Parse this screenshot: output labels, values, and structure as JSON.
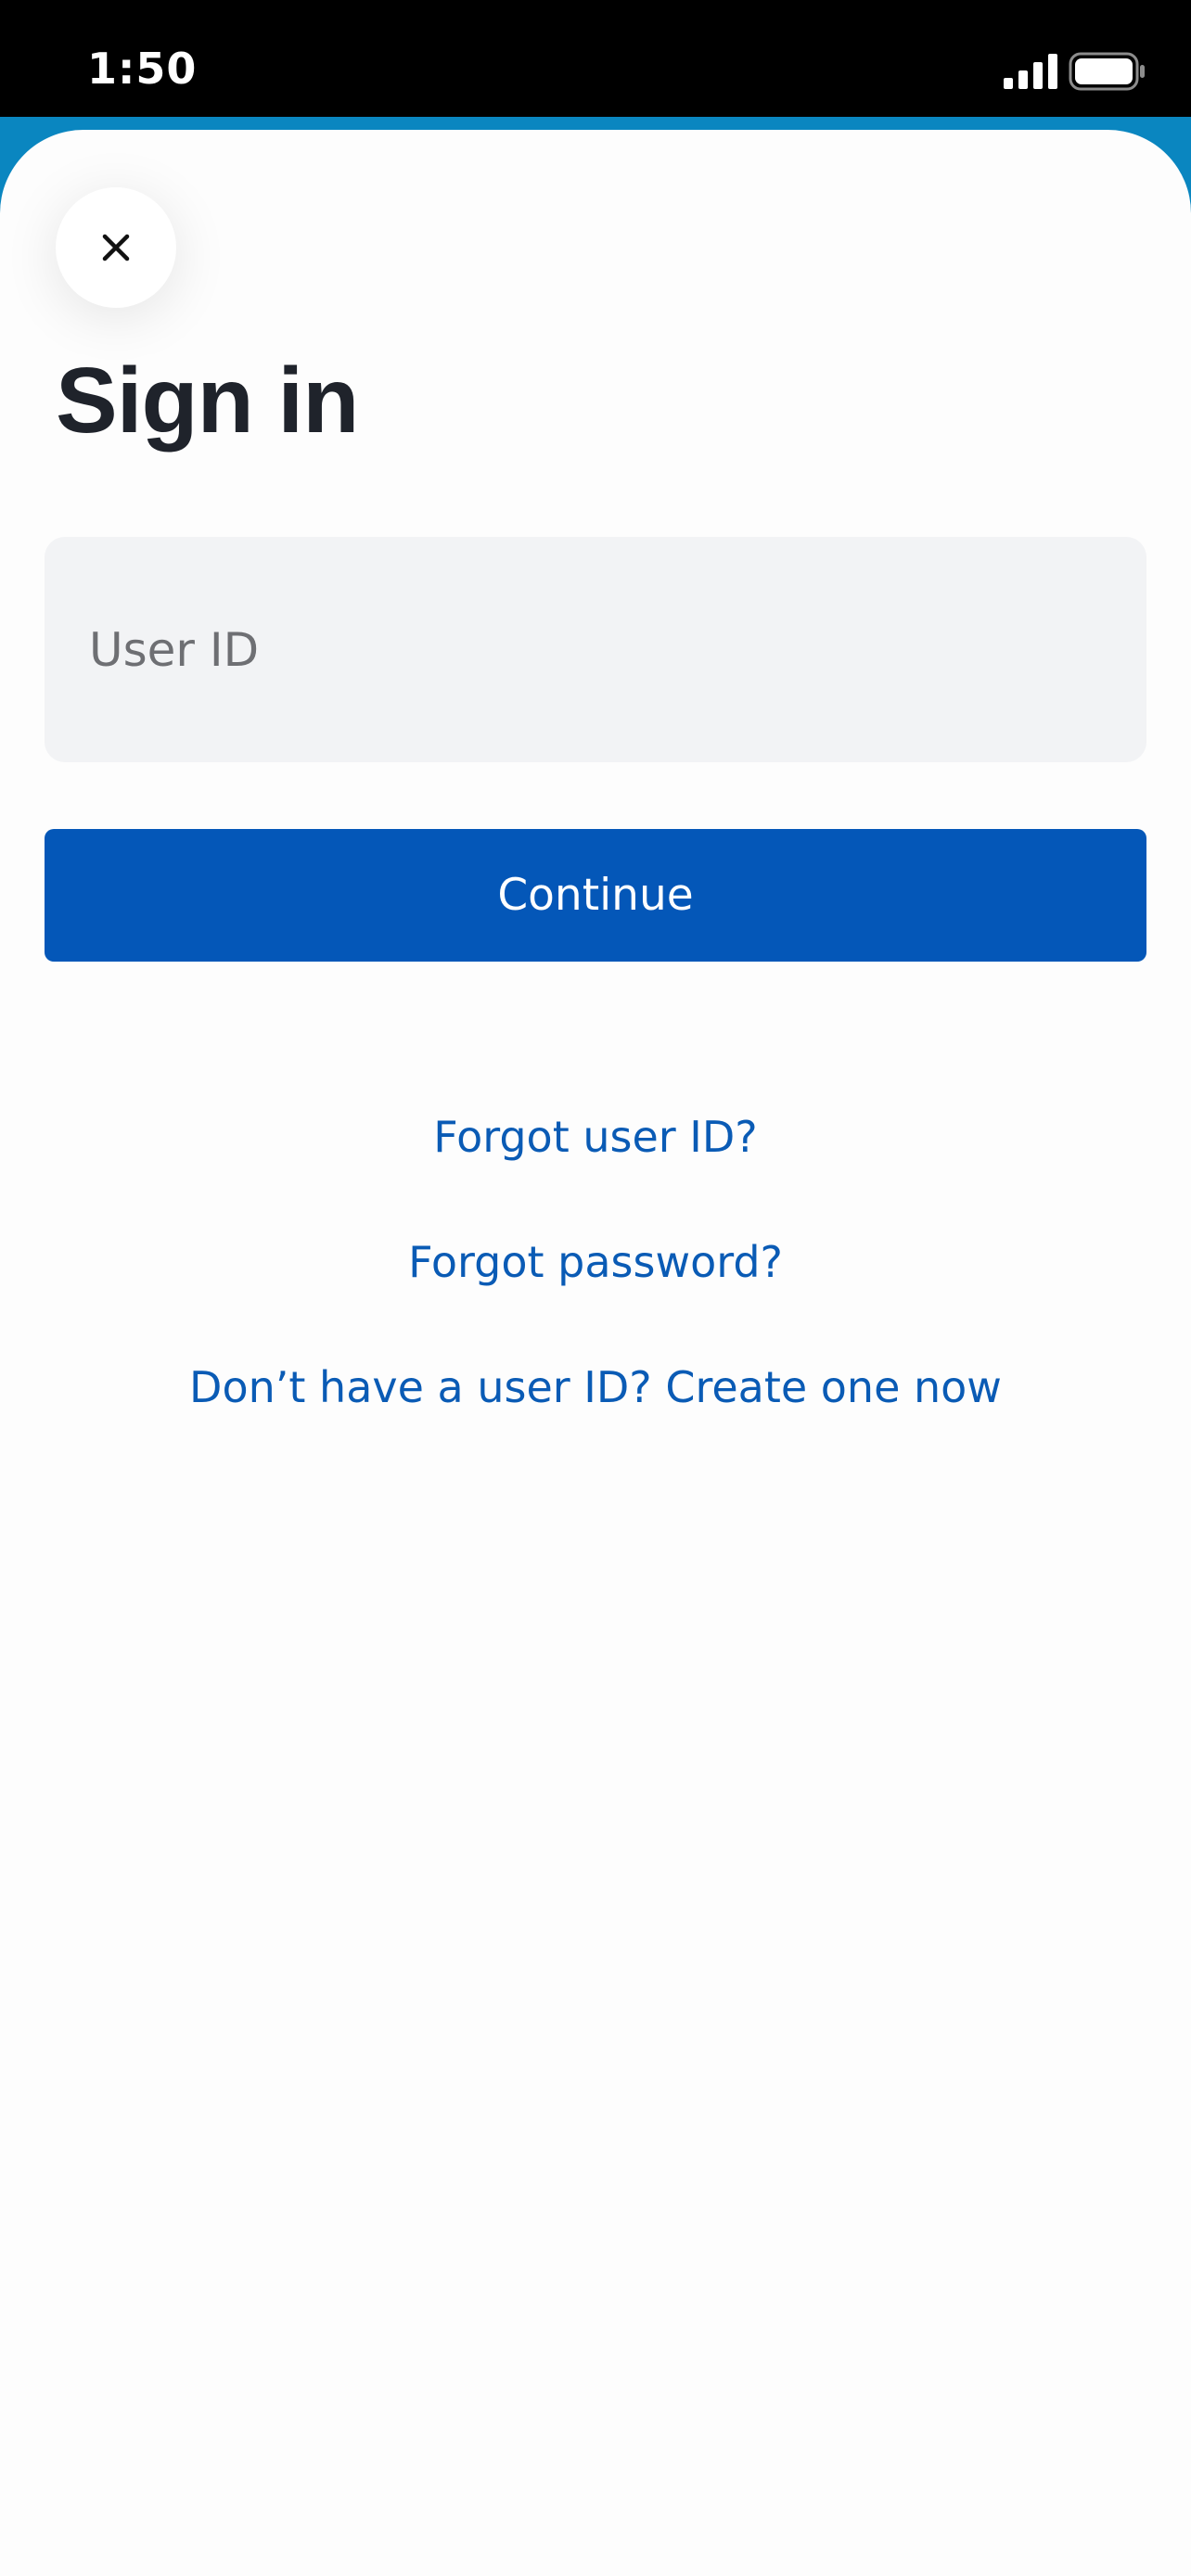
{
  "status_bar": {
    "time": "1:50",
    "signal_icon": "cellular-signal-icon",
    "battery_icon": "battery-icon"
  },
  "colors": {
    "backdrop": "#0a86c0",
    "primary_button": "#0457b8",
    "link": "#0a5bb5",
    "title": "#1f232b",
    "input_background": "#f2f3f5"
  },
  "sheet": {
    "close_icon": "close-icon",
    "title": "Sign in",
    "user_id_field": {
      "placeholder": "User ID",
      "value": ""
    },
    "continue_label": "Continue",
    "links": {
      "forgot_user_id": "Forgot user ID?",
      "forgot_password": "Forgot password?",
      "create_user_id": "Don’t have a user ID? Create one now"
    }
  }
}
